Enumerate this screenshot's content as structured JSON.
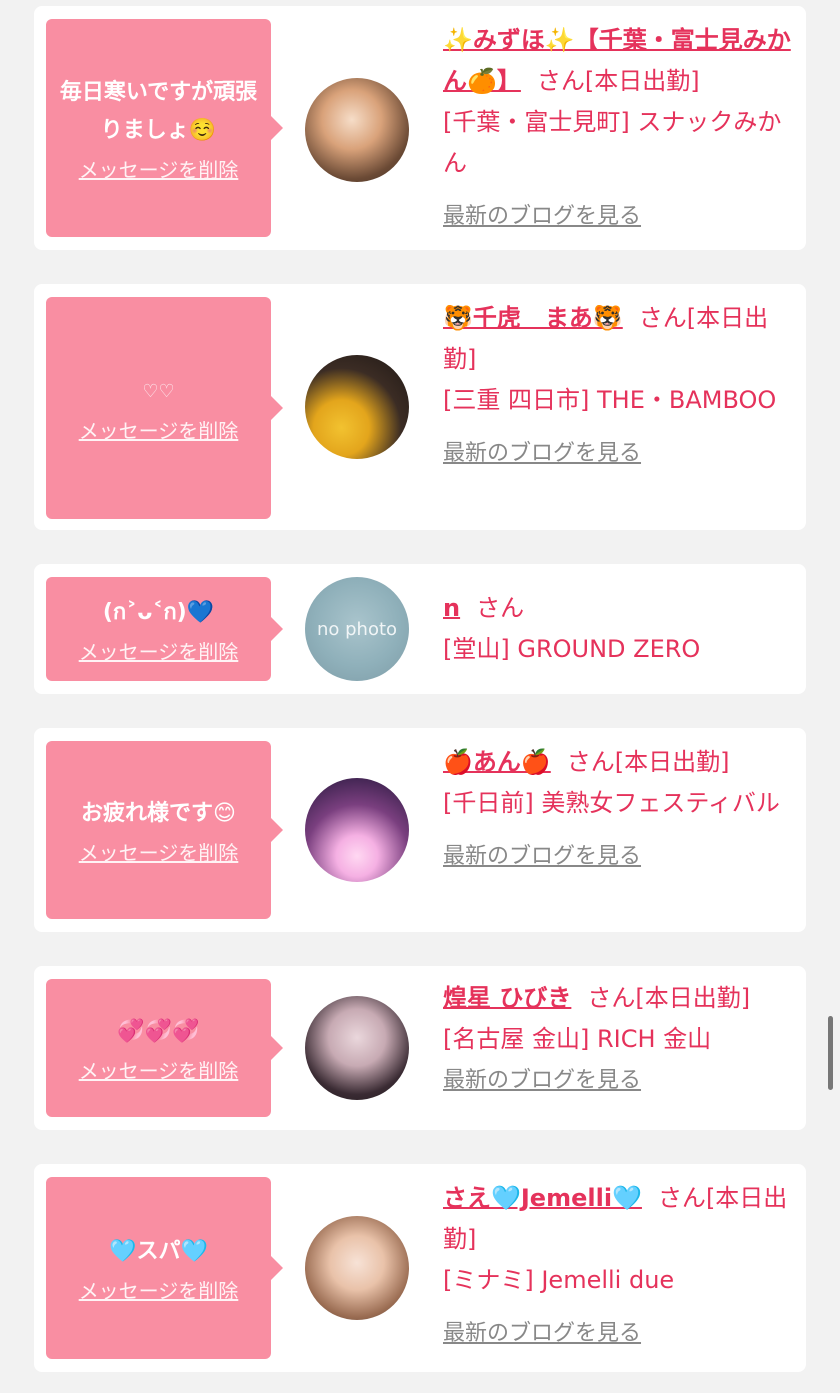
{
  "common": {
    "delete_label": "メッセージを削除",
    "san": "さん",
    "blog_link": "最新のブログを見る",
    "today_shift": "[本日出勤]"
  },
  "messages": [
    {
      "bubble_text": "毎日寒いですが頑張りましょ☺️",
      "name": "✨みずほ✨【千葉・富士見みかん🍊】",
      "shift_suffix": "[本日出勤]",
      "shop": "[千葉・富士見町] スナックみかん",
      "has_blog": true
    },
    {
      "bubble_text": "♡♡",
      "name": "🐯千虎　まあ🐯",
      "shift_suffix": "[本日出勤]",
      "shop": "[三重 四日市] THE・BAMBOO",
      "has_blog": true
    },
    {
      "bubble_text": "(ก˃ᴗ˂ก)💙",
      "name": "n",
      "shift_suffix": "",
      "shop": "[堂山] GROUND ZERO",
      "has_blog": false,
      "avatar_text": "no photo"
    },
    {
      "bubble_text": "お疲れ様です😊",
      "name": "🍎あん🍎",
      "shift_suffix": "[本日出勤]",
      "shop": "[千日前] 美熟女フェスティバル",
      "has_blog": true
    },
    {
      "bubble_text": "💞💞💞",
      "name": "煌星 ひびき",
      "shift_suffix": "[本日出勤]",
      "shop": "[名古屋 金山] RICH 金山",
      "has_blog": true
    },
    {
      "bubble_text": "🩵スパ🩵",
      "name": "さえ🩵Jemelli🩵",
      "shift_suffix": "[本日出勤]",
      "shop": "[ミナミ] Jemelli due",
      "has_blog": true
    }
  ],
  "colors": {
    "accent": "#e5325b",
    "bubble": "#f98ea2",
    "background": "#f2f2f2",
    "link_gray": "#888888"
  }
}
